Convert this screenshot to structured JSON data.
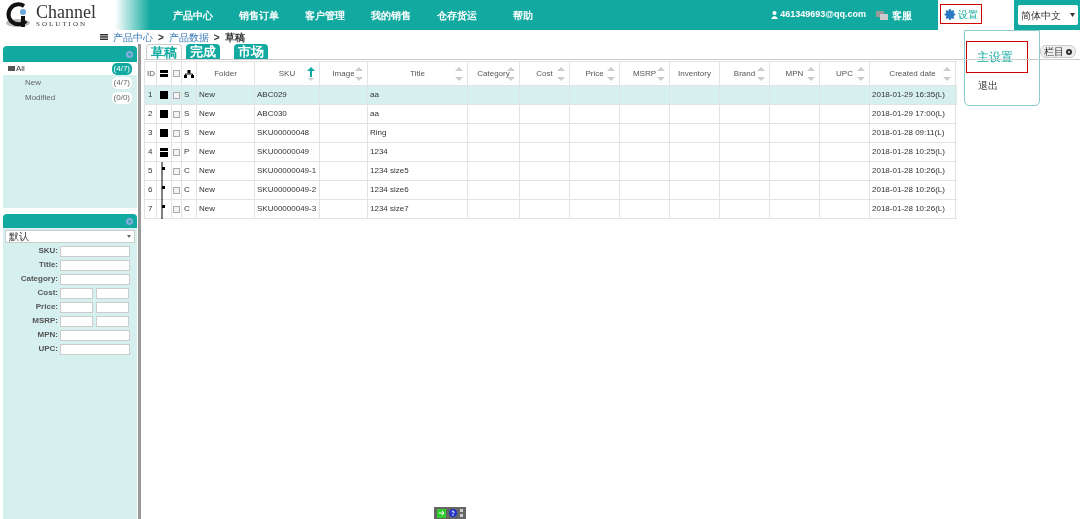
{
  "logo": {
    "text": "Channel",
    "subtext": "SOLUTION"
  },
  "nav": [
    "产品中心",
    "销售订单",
    "客户管理",
    "我的销售",
    "仓存货运",
    "帮助"
  ],
  "user": {
    "email": "461349693@qq.com",
    "service": "客服",
    "settings": "设置",
    "language": "简体中文"
  },
  "settings_menu": [
    {
      "label": "主设置",
      "highlighted": true
    },
    {
      "label": "退出",
      "highlighted": false
    }
  ],
  "breadcrumb": [
    {
      "label": "产品中心",
      "link": true
    },
    {
      "label": ">",
      "link": false
    },
    {
      "label": "产品数据",
      "link": true
    },
    {
      "label": ">",
      "link": false
    },
    {
      "label": "草稿",
      "link": false
    }
  ],
  "folders": [
    {
      "label": "All",
      "count": "(4/7)",
      "selected": true,
      "children": [
        {
          "label": "New",
          "count": "(4/7)",
          "selected": false
        },
        {
          "label": "Modified",
          "count": "(0/0)",
          "selected": false
        }
      ]
    }
  ],
  "filter": {
    "preset": "默认",
    "fields": [
      {
        "label": "SKU:",
        "kind": "single"
      },
      {
        "label": "Title:",
        "kind": "single"
      },
      {
        "label": "Category:",
        "kind": "single"
      },
      {
        "label": "Cost:",
        "kind": "range"
      },
      {
        "label": "Price:",
        "kind": "range"
      },
      {
        "label": "MSRP:",
        "kind": "range"
      },
      {
        "label": "MPN:",
        "kind": "single"
      },
      {
        "label": "UPC:",
        "kind": "single"
      }
    ]
  },
  "tabs": [
    {
      "label": "草稿",
      "selected": true
    },
    {
      "label": "完成",
      "selected": false
    },
    {
      "label": "市场",
      "selected": false
    }
  ],
  "columns_button": "栏目",
  "table": {
    "select_all_checked": false,
    "columns": [
      {
        "label": "ID",
        "sortable": false,
        "sorted": false
      },
      {
        "label": "Folder",
        "sortable": false,
        "sorted": false
      },
      {
        "label": "SKU",
        "sortable": true,
        "sorted": true
      },
      {
        "label": "Image",
        "sortable": true,
        "sorted": false
      },
      {
        "label": "Title",
        "sortable": true,
        "sorted": false
      },
      {
        "label": "Category",
        "sortable": true,
        "sorted": false
      },
      {
        "label": "Cost",
        "sortable": true,
        "sorted": false
      },
      {
        "label": "Price",
        "sortable": true,
        "sorted": false
      },
      {
        "label": "MSRP",
        "sortable": true,
        "sorted": false
      },
      {
        "label": "Inventory",
        "sortable": false,
        "sorted": false
      },
      {
        "label": "Brand",
        "sortable": true,
        "sorted": false
      },
      {
        "label": "MPN",
        "sortable": true,
        "sorted": false
      },
      {
        "label": "UPC",
        "sortable": true,
        "sorted": false
      },
      {
        "label": "Created date",
        "sortable": true,
        "sorted": false
      }
    ],
    "rows": [
      {
        "id": "1",
        "kind": "single",
        "type": "S",
        "folder": "New",
        "sku": "ABC029",
        "title": "aa",
        "created": "2018-01-29 16:35(L)",
        "selected": true,
        "checked": false
      },
      {
        "id": "2",
        "kind": "single",
        "type": "S",
        "folder": "New",
        "sku": "ABC030",
        "title": "aa",
        "created": "2018-01-29 17:00(L)",
        "selected": false,
        "checked": false
      },
      {
        "id": "3",
        "kind": "single",
        "type": "S",
        "folder": "New",
        "sku": "SKU00000048",
        "title": "Ring",
        "created": "2018-01-28 09:11(L)",
        "selected": false,
        "checked": false
      },
      {
        "id": "4",
        "kind": "parent",
        "type": "P",
        "folder": "New",
        "sku": "SKU00000049",
        "title": "1234",
        "created": "2018-01-28 10:25(L)",
        "selected": false,
        "checked": false
      },
      {
        "id": "5",
        "kind": "child",
        "type": "C",
        "folder": "New",
        "sku": "SKU00000049-1",
        "title": "1234 size5",
        "created": "2018-01-28 10:26(L)",
        "selected": false,
        "checked": false
      },
      {
        "id": "6",
        "kind": "child",
        "type": "C",
        "folder": "New",
        "sku": "SKU00000049-2",
        "title": "1234 size6",
        "created": "2018-01-28 10:26(L)",
        "selected": false,
        "checked": false
      },
      {
        "id": "7",
        "kind": "child",
        "type": "C",
        "folder": "New",
        "sku": "SKU00000049-3",
        "title": "1234 size7",
        "created": "2018-01-28 10:26(L)",
        "selected": false,
        "checked": false
      }
    ]
  }
}
